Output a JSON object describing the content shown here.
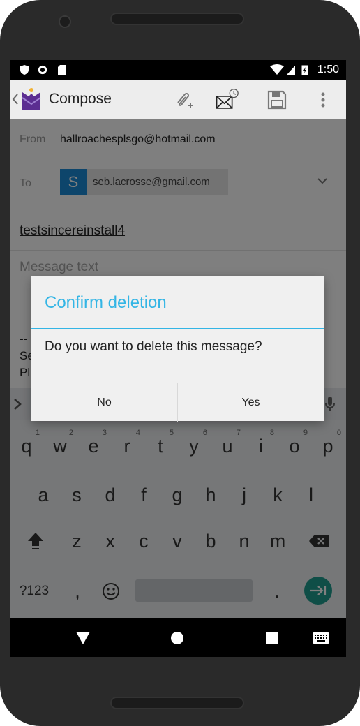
{
  "status_bar": {
    "time": "1:50"
  },
  "app_bar": {
    "title": "Compose",
    "icons": [
      "back-chevron-icon",
      "app-logo-icon",
      "attach-icon",
      "send-later-icon",
      "save-draft-icon",
      "overflow-menu-icon"
    ]
  },
  "compose": {
    "from_label": "From",
    "from_value": "hallroachesplsgo@hotmail.com",
    "to_label": "To",
    "to_chip_initial": "S",
    "to_chip_email": "seb.lacrosse@gmail.com",
    "subject": "testsincereinstall4",
    "message_placeholder": "Message text",
    "signature_lines": [
      "--",
      "Se",
      "Pl"
    ]
  },
  "keyboard": {
    "row1": [
      {
        "k": "q",
        "h": "1"
      },
      {
        "k": "w",
        "h": "2"
      },
      {
        "k": "e",
        "h": "3"
      },
      {
        "k": "r",
        "h": "4"
      },
      {
        "k": "t",
        "h": "5"
      },
      {
        "k": "y",
        "h": "6"
      },
      {
        "k": "u",
        "h": "7"
      },
      {
        "k": "i",
        "h": "8"
      },
      {
        "k": "o",
        "h": "9"
      },
      {
        "k": "p",
        "h": "0"
      }
    ],
    "row2": [
      "a",
      "s",
      "d",
      "f",
      "g",
      "h",
      "j",
      "k",
      "l"
    ],
    "row3": [
      "z",
      "x",
      "c",
      "v",
      "b",
      "n",
      "m"
    ],
    "symbols_key": "?123",
    "comma_key": ",",
    "period_key": "."
  },
  "dialog": {
    "title": "Confirm deletion",
    "message": "Do you want to delete this message?",
    "no_label": "No",
    "yes_label": "Yes"
  },
  "colors": {
    "dialog_accent": "#33b5e5",
    "chip_avatar": "#1a8bd6",
    "enter_key": "#1e9c8e"
  }
}
